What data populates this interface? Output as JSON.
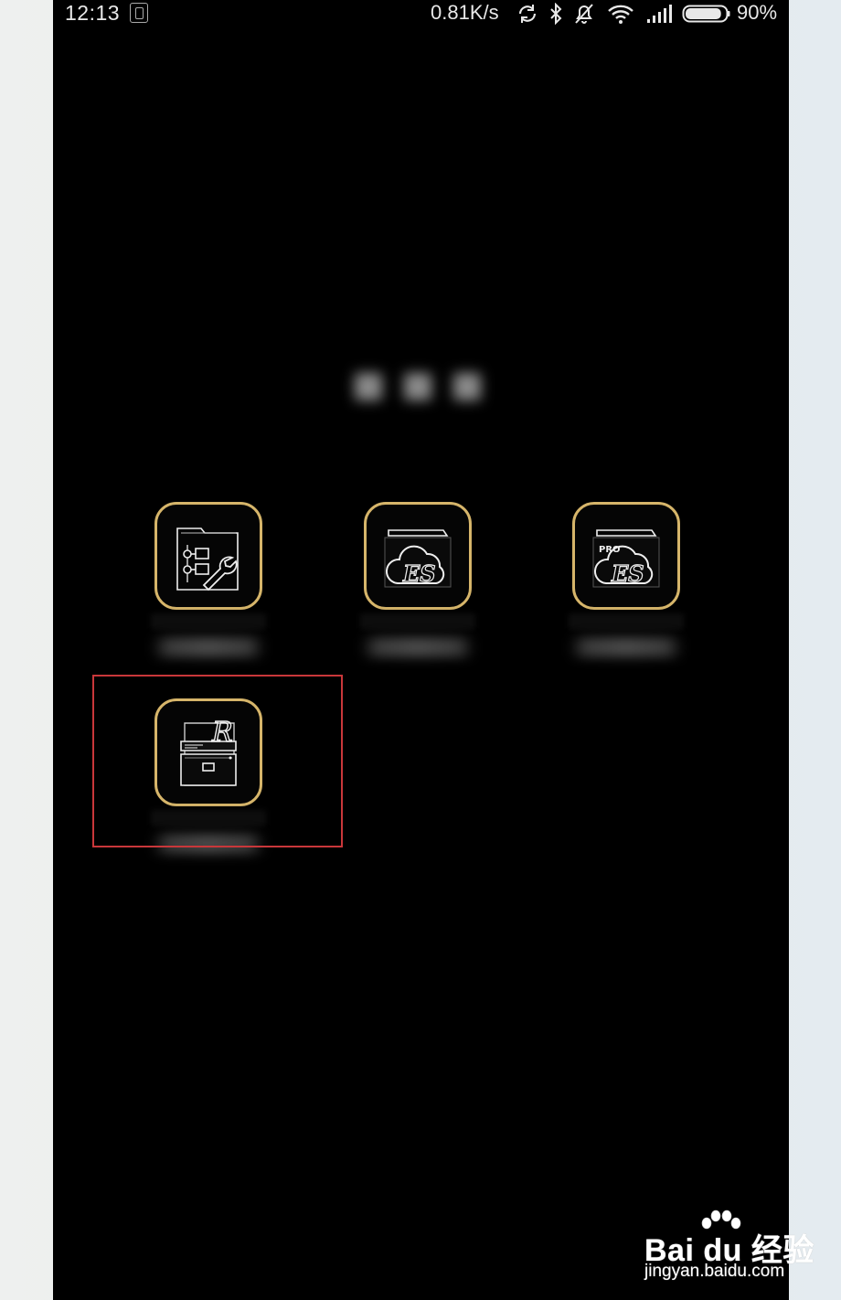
{
  "status_bar": {
    "time": "12:13",
    "net_speed": "0.81K/s",
    "battery_percent": "90%",
    "battery_level": 0.9,
    "icons": [
      "sim-icon",
      "sync-icon",
      "bluetooth-icon",
      "alarm-off-icon",
      "wifi-icon",
      "signal-icon",
      "battery-icon"
    ]
  },
  "folder": {
    "title": "",
    "apps": [
      {
        "icon": "file-manager-tools-icon",
        "label": ""
      },
      {
        "icon": "es-file-explorer-icon",
        "label": ""
      },
      {
        "icon": "es-file-explorer-pro-icon",
        "label": ""
      },
      {
        "icon": "root-explorer-icon",
        "label": ""
      }
    ],
    "highlighted_app": 3
  },
  "colors": {
    "icon_border": "#d6b56a",
    "highlight": "#c9373a",
    "background": "#000000"
  },
  "watermark": {
    "brand": "Bai du 经验",
    "url": "jingyan.baidu.com"
  }
}
